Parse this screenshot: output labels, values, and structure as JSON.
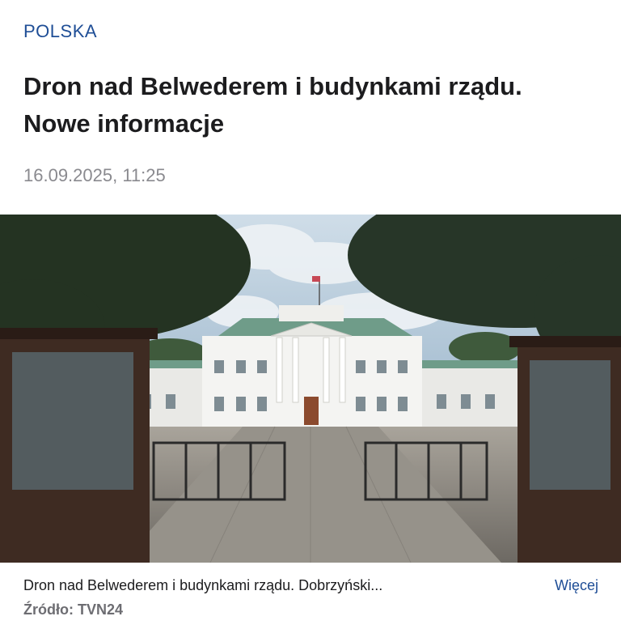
{
  "article": {
    "category": "POLSKA",
    "title_line1": "Dron nad Belwederem i budynkami rządu.",
    "title_line2": "Nowe informacje",
    "timestamp": "16.09.2025, 11:25"
  },
  "image": {
    "subject": "belweder-palace-photo",
    "caption": "Dron nad Belwederem i budynkami rządu. Dobrzyński...",
    "more_label": "Więcej",
    "source_label": "Źródło:",
    "source_name": "TVN24"
  },
  "colors": {
    "accent": "#1f4e96",
    "muted": "#8a8a8f",
    "text": "#1c1c1e"
  }
}
